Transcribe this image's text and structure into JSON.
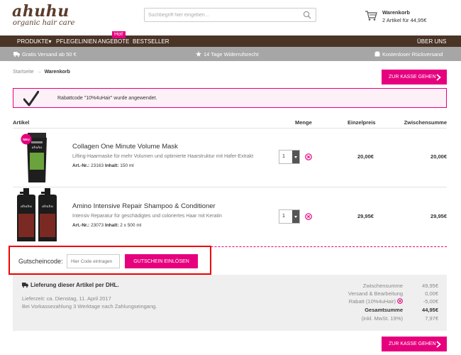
{
  "brand": {
    "name": "ahuhu",
    "tagline": "organic hair care"
  },
  "search": {
    "placeholder": "Suchbegriff hier eingeben..."
  },
  "cart": {
    "title": "Warenkorb",
    "summary": "2  Artikel für  44,95€"
  },
  "nav": {
    "items": [
      "PRODUKTE▾",
      "PFLEGELINIEN",
      "ANGEBOTE",
      "BESTSELLER"
    ],
    "hot_badge": "Hot!",
    "about": "ÜBER UNS"
  },
  "infobar": {
    "shipping": "Gratis Versand ab 50 €",
    "returns": "14 Tage Widerrufsrecht",
    "free_returns": "Kostenloser Rückversand"
  },
  "breadcrumb": {
    "home": "Startseite",
    "current": "Warenkorb"
  },
  "checkout_label": "ZUR KASSE GEHEN",
  "notice": {
    "message": "Rabattcode \"10%4uHair\" wurde angewendet."
  },
  "table": {
    "headers": {
      "article": "Artikel",
      "quantity": "Menge",
      "unit_price": "Einzelpreis",
      "subtotal": "Zwischensumme"
    }
  },
  "products": [
    {
      "name": "Collagen One Minute Volume Mask",
      "description": "Lifting-Haarmaske für mehr Volumen und optimierte Haarstruktur mit Hafer-Extrakt",
      "art_label": "Art.-Nr.:",
      "art_value": "23163",
      "content_label": "Inhalt:",
      "content_value": "150 ml",
      "badge": "NEU",
      "brand_on_pack": "ahuhu",
      "quantity": "1",
      "unit_price": "20,00€",
      "subtotal": "20,00€"
    },
    {
      "name": "Amino Intensive Repair Shampoo & Conditioner",
      "description": "Intensiv Reparatur für geschädigtes und coloriertes Haar mit Keratin",
      "art_label": "Art.-Nr.:",
      "art_value": "23073",
      "content_label": "Inhalt:",
      "content_value": "2 x 500 ml",
      "brand_on_pack": "ahuhu",
      "quantity": "1",
      "unit_price": "29,95€",
      "subtotal": "29,95€"
    }
  ],
  "voucher": {
    "label": "Gutscheincode:",
    "placeholder": "Hier Code eintragen",
    "button": "GUTSCHEIN EINLÖSEN"
  },
  "shipping_info": {
    "title": "Lieferung dieser Artikel per DHL.",
    "delivery_time": "Lieferzeit: ca. Dienstag, 11. April 2017",
    "prepayment_note": "Bei Vorkassezahlung 3 Werktage nach Zahlungseingang."
  },
  "totals": {
    "subtotal_label": "Zwischensumme",
    "subtotal": "49,95€",
    "shipping_label": "Versand & Bearbeitung",
    "shipping": "0,00€",
    "discount_label": "Rabatt (10%4uHair)",
    "discount": "-5,00€",
    "total_label": "Gesamtsumme",
    "total": "44,95€",
    "vat_label": "(inkl. MwSt. 19%)",
    "vat": "7,97€"
  },
  "colors": {
    "accent": "#e6007e",
    "nav_bg": "#4a3426",
    "infobar_bg": "#a6a6a6",
    "highlight_border": "#ee0000"
  }
}
